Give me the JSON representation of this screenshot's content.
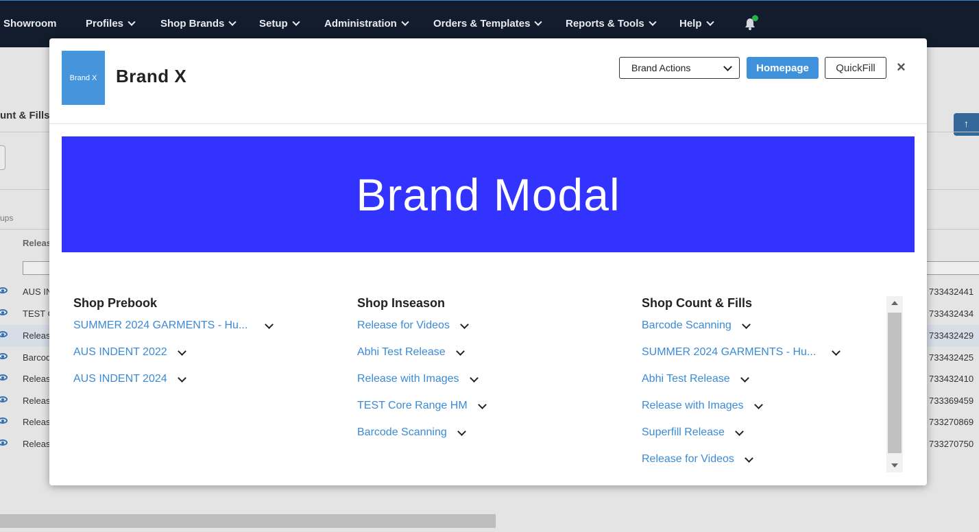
{
  "nav": {
    "items": [
      {
        "label": "Showroom",
        "chevron": false
      },
      {
        "label": "Profiles",
        "chevron": true
      },
      {
        "label": "Shop Brands",
        "chevron": true
      },
      {
        "label": "Setup",
        "chevron": true
      },
      {
        "label": "Administration",
        "chevron": true
      },
      {
        "label": "Orders & Templates",
        "chevron": true
      },
      {
        "label": "Reports & Tools",
        "chevron": true
      },
      {
        "label": "Help",
        "chevron": true
      }
    ],
    "notification_icon": "bell-icon"
  },
  "background": {
    "section_title": "unt & Fills",
    "groups_label": "ups",
    "column_header": "Releas",
    "rows": [
      {
        "name": "AUS IN",
        "number": "733432441"
      },
      {
        "name": "TEST C",
        "number": "733432434"
      },
      {
        "name": "Releas",
        "number": "733432429"
      },
      {
        "name": "Barcod",
        "number": "733432425"
      },
      {
        "name": "Releas",
        "number": "733432410"
      },
      {
        "name": "Releas",
        "number": "733369459"
      },
      {
        "name": "Releas",
        "number": "733270869"
      },
      {
        "name": "Releas",
        "number": "733270750"
      }
    ]
  },
  "modal": {
    "logo_text": "Brand X",
    "title": "Brand X",
    "brand_actions": "Brand Actions",
    "homepage_button": "Homepage",
    "quickfill_button": "QuickFill",
    "close_symbol": "×",
    "banner_text": "Brand Modal",
    "columns": [
      {
        "title": "Shop Prebook",
        "links": [
          "SUMMER 2024 GARMENTS - Hu...",
          "AUS INDENT 2022",
          "AUS INDENT 2024"
        ]
      },
      {
        "title": "Shop Inseason",
        "links": [
          "Release for Videos",
          "Abhi Test Release",
          "Release with Images",
          "TEST Core Range HM",
          "Barcode Scanning"
        ]
      },
      {
        "title": "Shop Count & Fills",
        "links": [
          "Barcode Scanning",
          "SUMMER 2024 GARMENTS - Hu...",
          "Abhi Test Release",
          "Release with Images",
          "Superfill Release",
          "Release for Videos"
        ]
      }
    ]
  },
  "colors": {
    "nav_bg": "#121c2c",
    "link": "#3a8ad6",
    "primary_button": "#3f91dc",
    "banner_bg": "#3333ff"
  }
}
